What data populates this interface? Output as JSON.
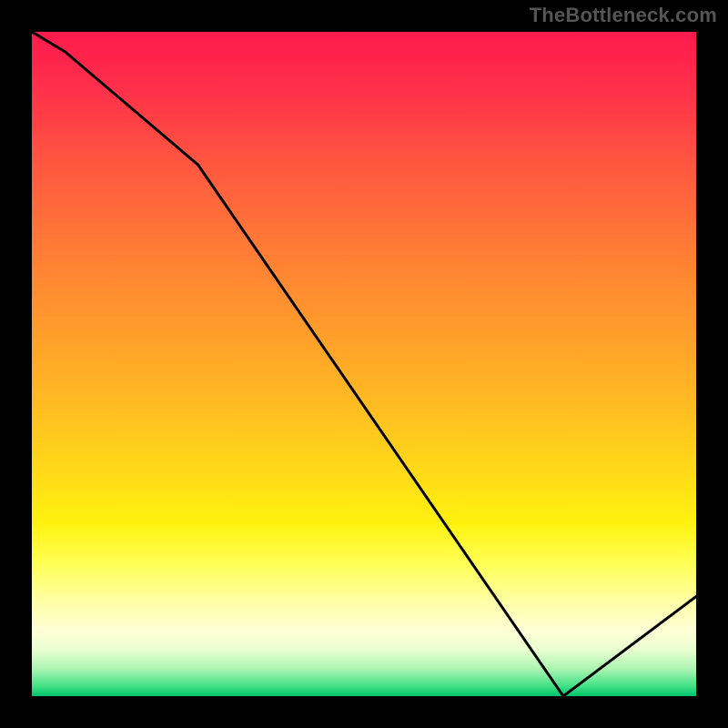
{
  "attribution": "TheBottleneck.com",
  "chart_data": {
    "type": "line",
    "title": "",
    "xlabel": "",
    "ylabel": "",
    "xlim": [
      0,
      100
    ],
    "ylim": [
      0,
      100
    ],
    "x": [
      0,
      5,
      25,
      80,
      100
    ],
    "y": [
      100,
      97,
      80,
      0,
      15
    ],
    "marker": {
      "x": 79,
      "y": 0.5,
      "label": ""
    },
    "background_gradient": {
      "top_color": "#ff1a4d",
      "mid_color": "#ffff55",
      "bottom_color": "#00c46b"
    }
  }
}
